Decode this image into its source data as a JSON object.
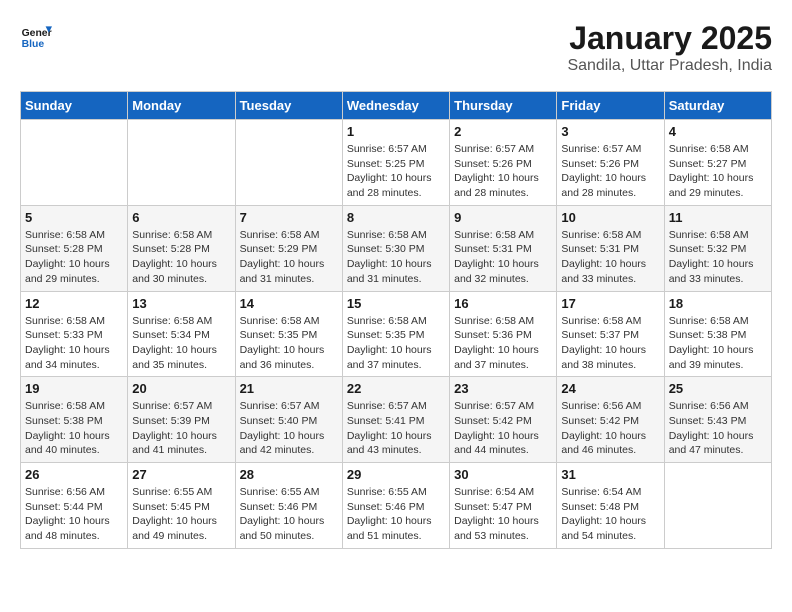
{
  "header": {
    "logo_line1": "General",
    "logo_line2": "Blue",
    "title": "January 2025",
    "subtitle": "Sandila, Uttar Pradesh, India"
  },
  "weekdays": [
    "Sunday",
    "Monday",
    "Tuesday",
    "Wednesday",
    "Thursday",
    "Friday",
    "Saturday"
  ],
  "weeks": [
    [
      {
        "day": "",
        "sunrise": "",
        "sunset": "",
        "daylight": ""
      },
      {
        "day": "",
        "sunrise": "",
        "sunset": "",
        "daylight": ""
      },
      {
        "day": "",
        "sunrise": "",
        "sunset": "",
        "daylight": ""
      },
      {
        "day": "1",
        "sunrise": "Sunrise: 6:57 AM",
        "sunset": "Sunset: 5:25 PM",
        "daylight": "Daylight: 10 hours and 28 minutes."
      },
      {
        "day": "2",
        "sunrise": "Sunrise: 6:57 AM",
        "sunset": "Sunset: 5:26 PM",
        "daylight": "Daylight: 10 hours and 28 minutes."
      },
      {
        "day": "3",
        "sunrise": "Sunrise: 6:57 AM",
        "sunset": "Sunset: 5:26 PM",
        "daylight": "Daylight: 10 hours and 28 minutes."
      },
      {
        "day": "4",
        "sunrise": "Sunrise: 6:58 AM",
        "sunset": "Sunset: 5:27 PM",
        "daylight": "Daylight: 10 hours and 29 minutes."
      }
    ],
    [
      {
        "day": "5",
        "sunrise": "Sunrise: 6:58 AM",
        "sunset": "Sunset: 5:28 PM",
        "daylight": "Daylight: 10 hours and 29 minutes."
      },
      {
        "day": "6",
        "sunrise": "Sunrise: 6:58 AM",
        "sunset": "Sunset: 5:28 PM",
        "daylight": "Daylight: 10 hours and 30 minutes."
      },
      {
        "day": "7",
        "sunrise": "Sunrise: 6:58 AM",
        "sunset": "Sunset: 5:29 PM",
        "daylight": "Daylight: 10 hours and 31 minutes."
      },
      {
        "day": "8",
        "sunrise": "Sunrise: 6:58 AM",
        "sunset": "Sunset: 5:30 PM",
        "daylight": "Daylight: 10 hours and 31 minutes."
      },
      {
        "day": "9",
        "sunrise": "Sunrise: 6:58 AM",
        "sunset": "Sunset: 5:31 PM",
        "daylight": "Daylight: 10 hours and 32 minutes."
      },
      {
        "day": "10",
        "sunrise": "Sunrise: 6:58 AM",
        "sunset": "Sunset: 5:31 PM",
        "daylight": "Daylight: 10 hours and 33 minutes."
      },
      {
        "day": "11",
        "sunrise": "Sunrise: 6:58 AM",
        "sunset": "Sunset: 5:32 PM",
        "daylight": "Daylight: 10 hours and 33 minutes."
      }
    ],
    [
      {
        "day": "12",
        "sunrise": "Sunrise: 6:58 AM",
        "sunset": "Sunset: 5:33 PM",
        "daylight": "Daylight: 10 hours and 34 minutes."
      },
      {
        "day": "13",
        "sunrise": "Sunrise: 6:58 AM",
        "sunset": "Sunset: 5:34 PM",
        "daylight": "Daylight: 10 hours and 35 minutes."
      },
      {
        "day": "14",
        "sunrise": "Sunrise: 6:58 AM",
        "sunset": "Sunset: 5:35 PM",
        "daylight": "Daylight: 10 hours and 36 minutes."
      },
      {
        "day": "15",
        "sunrise": "Sunrise: 6:58 AM",
        "sunset": "Sunset: 5:35 PM",
        "daylight": "Daylight: 10 hours and 37 minutes."
      },
      {
        "day": "16",
        "sunrise": "Sunrise: 6:58 AM",
        "sunset": "Sunset: 5:36 PM",
        "daylight": "Daylight: 10 hours and 37 minutes."
      },
      {
        "day": "17",
        "sunrise": "Sunrise: 6:58 AM",
        "sunset": "Sunset: 5:37 PM",
        "daylight": "Daylight: 10 hours and 38 minutes."
      },
      {
        "day": "18",
        "sunrise": "Sunrise: 6:58 AM",
        "sunset": "Sunset: 5:38 PM",
        "daylight": "Daylight: 10 hours and 39 minutes."
      }
    ],
    [
      {
        "day": "19",
        "sunrise": "Sunrise: 6:58 AM",
        "sunset": "Sunset: 5:38 PM",
        "daylight": "Daylight: 10 hours and 40 minutes."
      },
      {
        "day": "20",
        "sunrise": "Sunrise: 6:57 AM",
        "sunset": "Sunset: 5:39 PM",
        "daylight": "Daylight: 10 hours and 41 minutes."
      },
      {
        "day": "21",
        "sunrise": "Sunrise: 6:57 AM",
        "sunset": "Sunset: 5:40 PM",
        "daylight": "Daylight: 10 hours and 42 minutes."
      },
      {
        "day": "22",
        "sunrise": "Sunrise: 6:57 AM",
        "sunset": "Sunset: 5:41 PM",
        "daylight": "Daylight: 10 hours and 43 minutes."
      },
      {
        "day": "23",
        "sunrise": "Sunrise: 6:57 AM",
        "sunset": "Sunset: 5:42 PM",
        "daylight": "Daylight: 10 hours and 44 minutes."
      },
      {
        "day": "24",
        "sunrise": "Sunrise: 6:56 AM",
        "sunset": "Sunset: 5:42 PM",
        "daylight": "Daylight: 10 hours and 46 minutes."
      },
      {
        "day": "25",
        "sunrise": "Sunrise: 6:56 AM",
        "sunset": "Sunset: 5:43 PM",
        "daylight": "Daylight: 10 hours and 47 minutes."
      }
    ],
    [
      {
        "day": "26",
        "sunrise": "Sunrise: 6:56 AM",
        "sunset": "Sunset: 5:44 PM",
        "daylight": "Daylight: 10 hours and 48 minutes."
      },
      {
        "day": "27",
        "sunrise": "Sunrise: 6:55 AM",
        "sunset": "Sunset: 5:45 PM",
        "daylight": "Daylight: 10 hours and 49 minutes."
      },
      {
        "day": "28",
        "sunrise": "Sunrise: 6:55 AM",
        "sunset": "Sunset: 5:46 PM",
        "daylight": "Daylight: 10 hours and 50 minutes."
      },
      {
        "day": "29",
        "sunrise": "Sunrise: 6:55 AM",
        "sunset": "Sunset: 5:46 PM",
        "daylight": "Daylight: 10 hours and 51 minutes."
      },
      {
        "day": "30",
        "sunrise": "Sunrise: 6:54 AM",
        "sunset": "Sunset: 5:47 PM",
        "daylight": "Daylight: 10 hours and 53 minutes."
      },
      {
        "day": "31",
        "sunrise": "Sunrise: 6:54 AM",
        "sunset": "Sunset: 5:48 PM",
        "daylight": "Daylight: 10 hours and 54 minutes."
      },
      {
        "day": "",
        "sunrise": "",
        "sunset": "",
        "daylight": ""
      }
    ]
  ]
}
